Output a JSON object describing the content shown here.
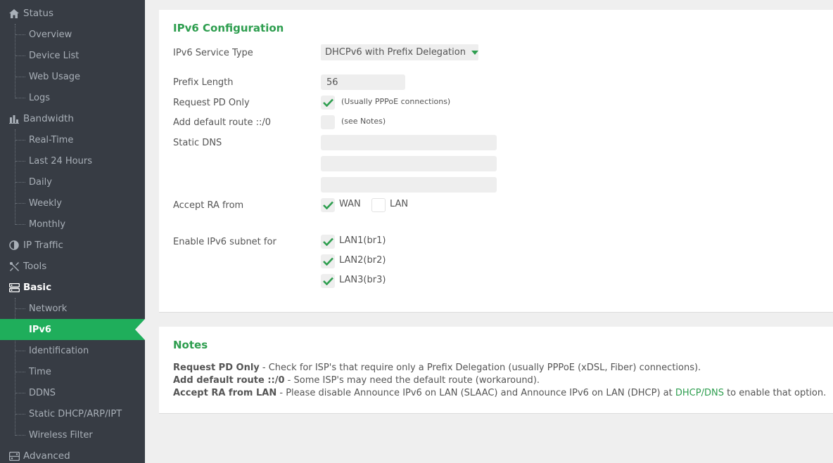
{
  "sidebar": {
    "status": {
      "label": "Status",
      "items": [
        "Overview",
        "Device List",
        "Web Usage",
        "Logs"
      ]
    },
    "bandwidth": {
      "label": "Bandwidth",
      "items": [
        "Real-Time",
        "Last 24 Hours",
        "Daily",
        "Weekly",
        "Monthly"
      ]
    },
    "ip_traffic": {
      "label": "IP Traffic"
    },
    "tools": {
      "label": "Tools"
    },
    "basic": {
      "label": "Basic",
      "items": [
        "Network",
        "IPv6",
        "Identification",
        "Time",
        "DDNS",
        "Static DHCP/ARP/IPT",
        "Wireless Filter"
      ]
    },
    "advanced": {
      "label": "Advanced"
    },
    "current_item": "IPv6"
  },
  "config": {
    "title": "IPv6 Configuration",
    "service_type": {
      "label": "IPv6 Service Type",
      "value": "DHCPv6 with Prefix Delegation"
    },
    "prefix_length": {
      "label": "Prefix Length",
      "value": "56"
    },
    "request_pd": {
      "label": "Request PD Only",
      "checked": true,
      "hint": "(Usually PPPoE connections)"
    },
    "default_route": {
      "label": "Add default route ::/0",
      "checked": false,
      "hint": "(see Notes)"
    },
    "static_dns": {
      "label": "Static DNS",
      "values": [
        "",
        "",
        ""
      ]
    },
    "accept_ra": {
      "label": "Accept RA from",
      "wan": {
        "label": "WAN",
        "checked": true
      },
      "lan": {
        "label": "LAN",
        "checked": false
      }
    },
    "subnets": {
      "label": "Enable IPv6 subnet for",
      "items": [
        {
          "label": "LAN1(br1)",
          "checked": true
        },
        {
          "label": "LAN2(br2)",
          "checked": true
        },
        {
          "label": "LAN3(br3)",
          "checked": true
        }
      ]
    }
  },
  "notes": {
    "title": "Notes",
    "lines": [
      {
        "term": "Request PD Only",
        "text": " - Check for ISP's that require only a Prefix Delegation (usually PPPoE (xDSL, Fiber) connections)."
      },
      {
        "term": "Add default route ::/0",
        "text": " - Some ISP's may need the default route (workaround)."
      },
      {
        "term": "Accept RA from LAN",
        "text": " - Please disable Announce IPv6 on LAN (SLAAC) and Announce IPv6 on LAN (DHCP) at ",
        "link": "DHCP/DNS",
        "tail": " to enable that option."
      }
    ]
  },
  "colors": {
    "accent": "#2e9e4f",
    "sidebar_bg": "#373c44",
    "active_bg": "#1fae5b"
  },
  "icons": {
    "status": "home-icon",
    "bandwidth": "bar-chart-icon",
    "ip_traffic": "pie-icon",
    "tools": "tools-icon",
    "basic": "server-icon",
    "advanced": "advanced-icon"
  }
}
